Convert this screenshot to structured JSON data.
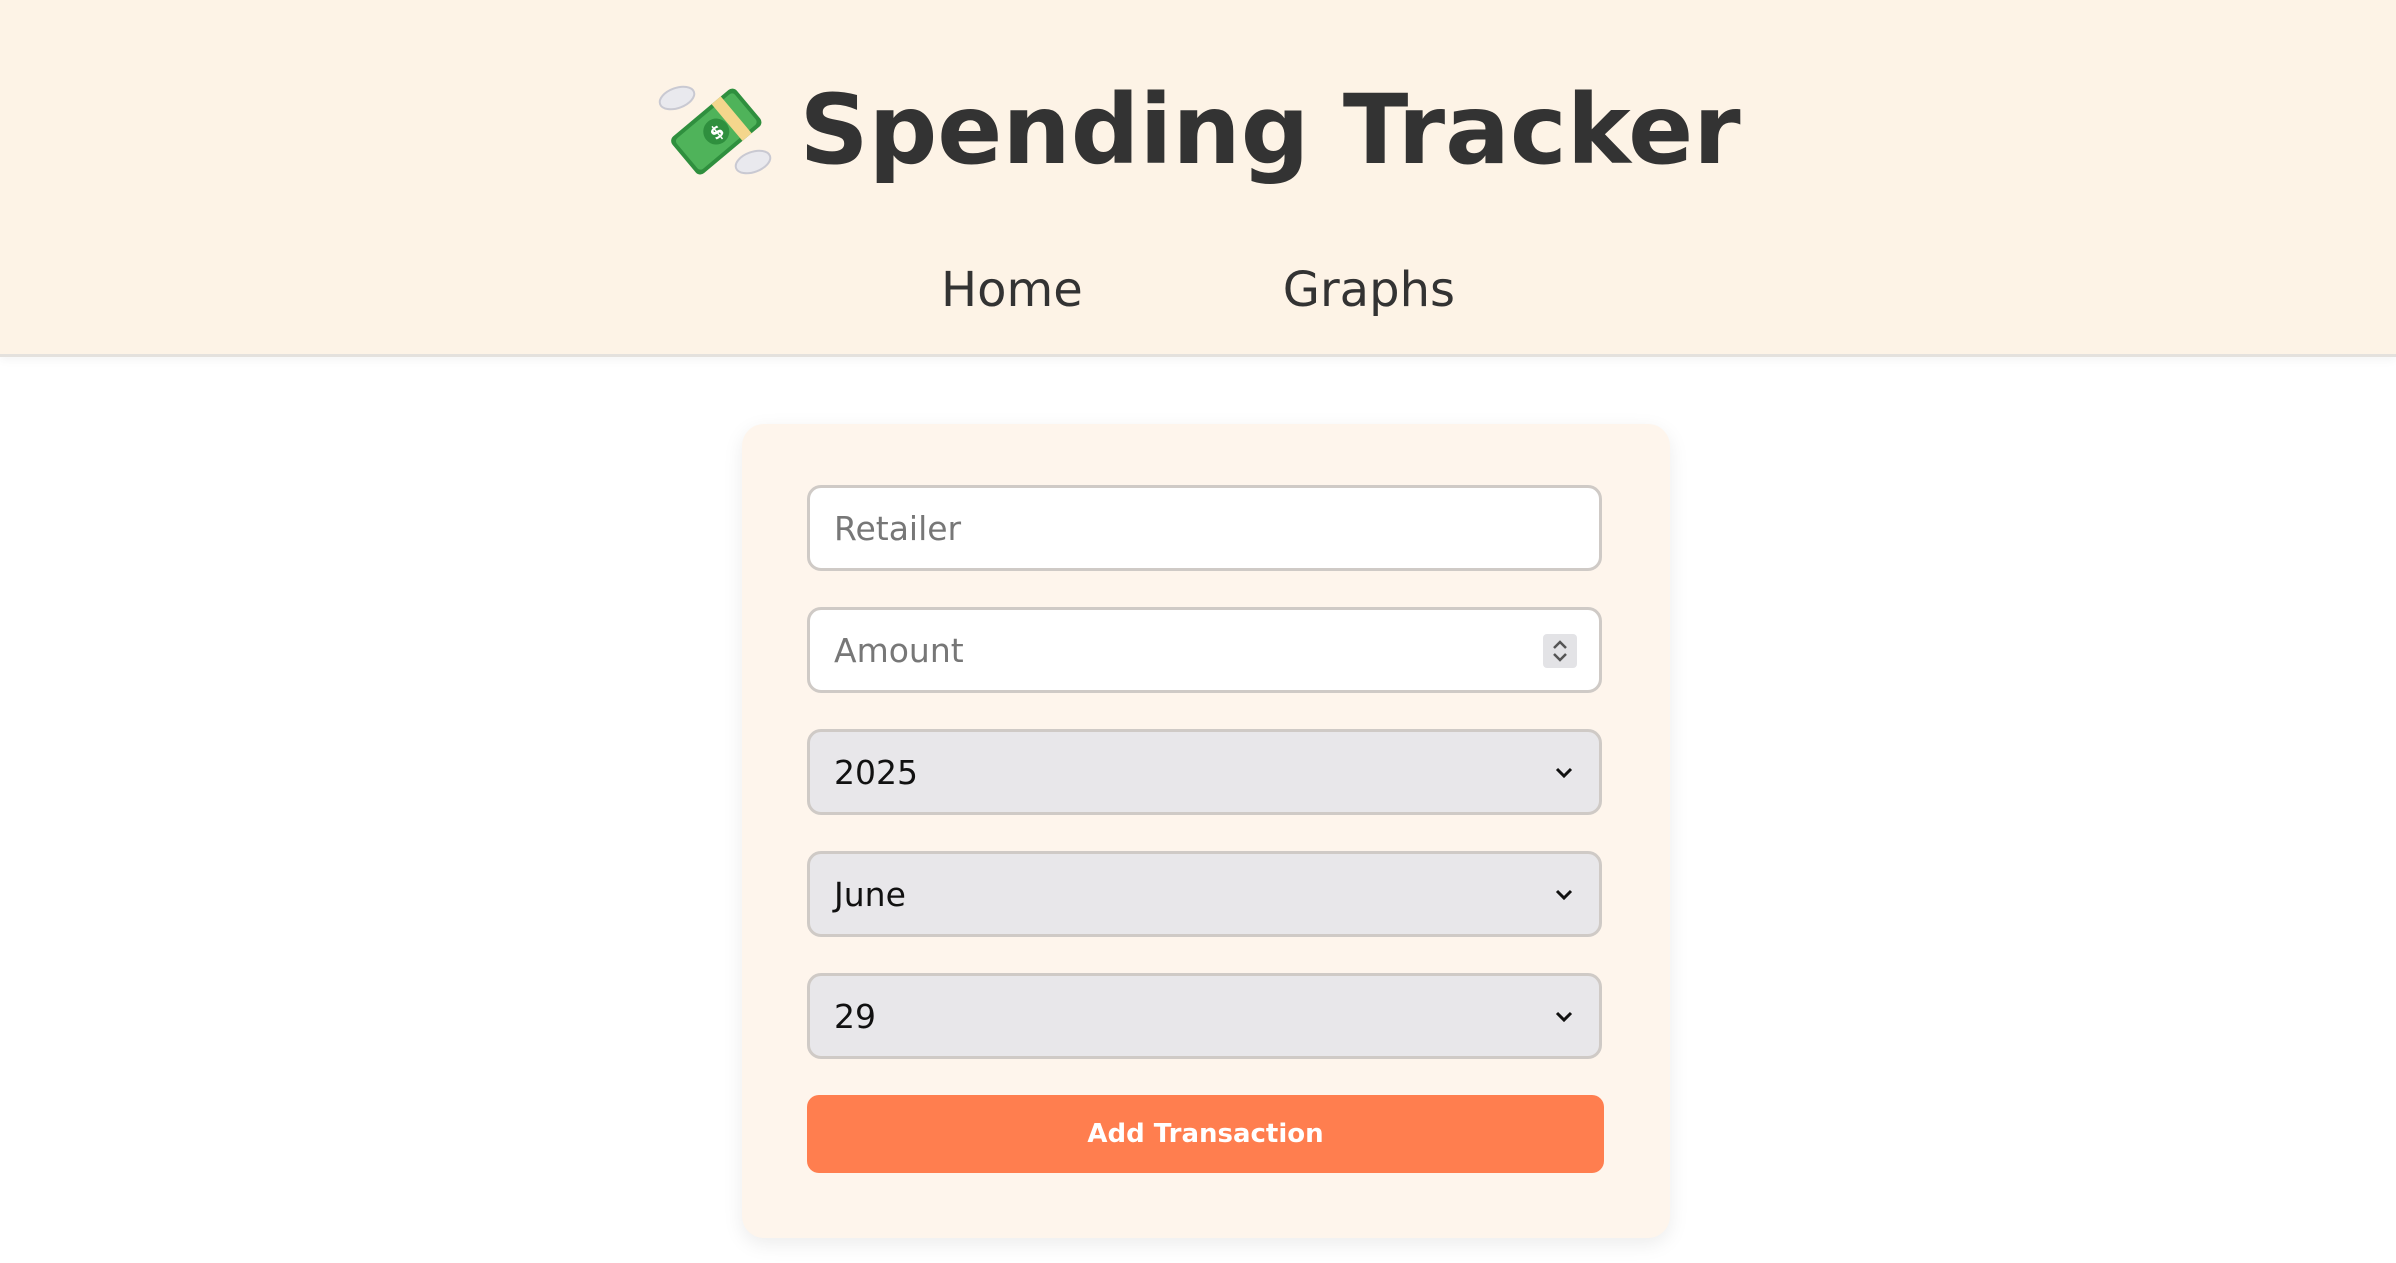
{
  "app": {
    "title": "Spending Tracker",
    "logo_icon": "money-with-wings-icon"
  },
  "nav": {
    "items": [
      {
        "label": "Home"
      },
      {
        "label": "Graphs"
      }
    ]
  },
  "form": {
    "retailer": {
      "placeholder": "Retailer",
      "value": ""
    },
    "amount": {
      "placeholder": "Amount",
      "value": ""
    },
    "year": {
      "selected": "2025"
    },
    "month": {
      "selected": "June"
    },
    "day": {
      "selected": "29"
    },
    "submit_label": "Add Transaction"
  },
  "colors": {
    "header_bg": "#fdf3e6",
    "card_bg": "#fef5ec",
    "accent": "#ff7e4f",
    "select_bg": "#e8e7ea"
  }
}
